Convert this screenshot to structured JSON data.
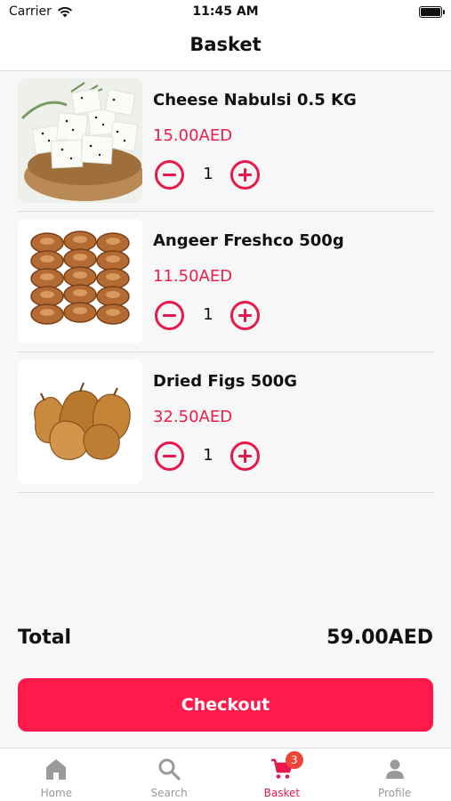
{
  "status_bar": {
    "carrier": "Carrier",
    "time": "11:45 AM"
  },
  "header": {
    "title": "Basket"
  },
  "items": [
    {
      "name": "Cheese Nabulsi 0.5 KG",
      "price": "15.00AED",
      "quantity": "1",
      "image": "cheese-image"
    },
    {
      "name": "Angeer Freshco 500g",
      "price": "11.50AED",
      "quantity": "1",
      "image": "figs-rows-image"
    },
    {
      "name": "Dried Figs 500G",
      "price": "32.50AED",
      "quantity": "1",
      "image": "dried-figs-image"
    }
  ],
  "summary": {
    "total_label": "Total",
    "total_value": "59.00AED"
  },
  "checkout": {
    "label": "Checkout"
  },
  "tabs": [
    {
      "label": "Home",
      "icon": "home-icon"
    },
    {
      "label": "Search",
      "icon": "search-icon"
    },
    {
      "label": "Basket",
      "icon": "cart-icon",
      "badge": "3",
      "active": true
    },
    {
      "label": "Profile",
      "icon": "person-icon"
    }
  ],
  "colors": {
    "accent": "#ff1a4b",
    "price": "#ee1c4a",
    "badge": "#f04438",
    "inactive_tab": "#9a9a9a"
  }
}
